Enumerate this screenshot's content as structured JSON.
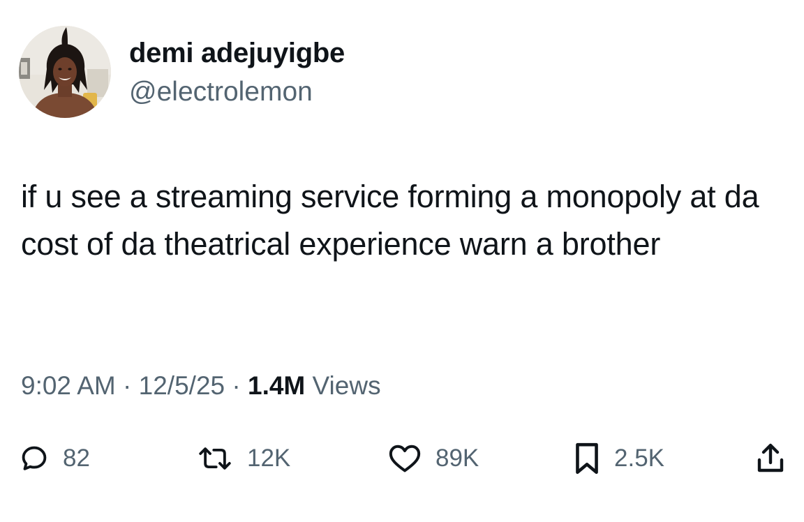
{
  "author": {
    "name": "demi adejuyigbe",
    "handle": "@electrolemon"
  },
  "tweet": {
    "text": "if u see a streaming service forming a monopoly at da cost of da theatrical experience warn a brother"
  },
  "meta": {
    "time": "9:02 AM",
    "separator": "·",
    "date": "12/5/25",
    "views_count": "1.4M",
    "views_label": "Views"
  },
  "actions": {
    "replies": "82",
    "retweets": "12K",
    "likes": "89K",
    "bookmarks": "2.5K"
  },
  "icons": {
    "reply": "speech-bubble-icon",
    "retweet": "retweet-arrows-icon",
    "like": "heart-outline-icon",
    "bookmark": "bookmark-outline-icon",
    "share": "share-upload-icon"
  },
  "colors": {
    "text_primary": "#0f1419",
    "text_secondary": "#536471",
    "background": "#ffffff"
  }
}
